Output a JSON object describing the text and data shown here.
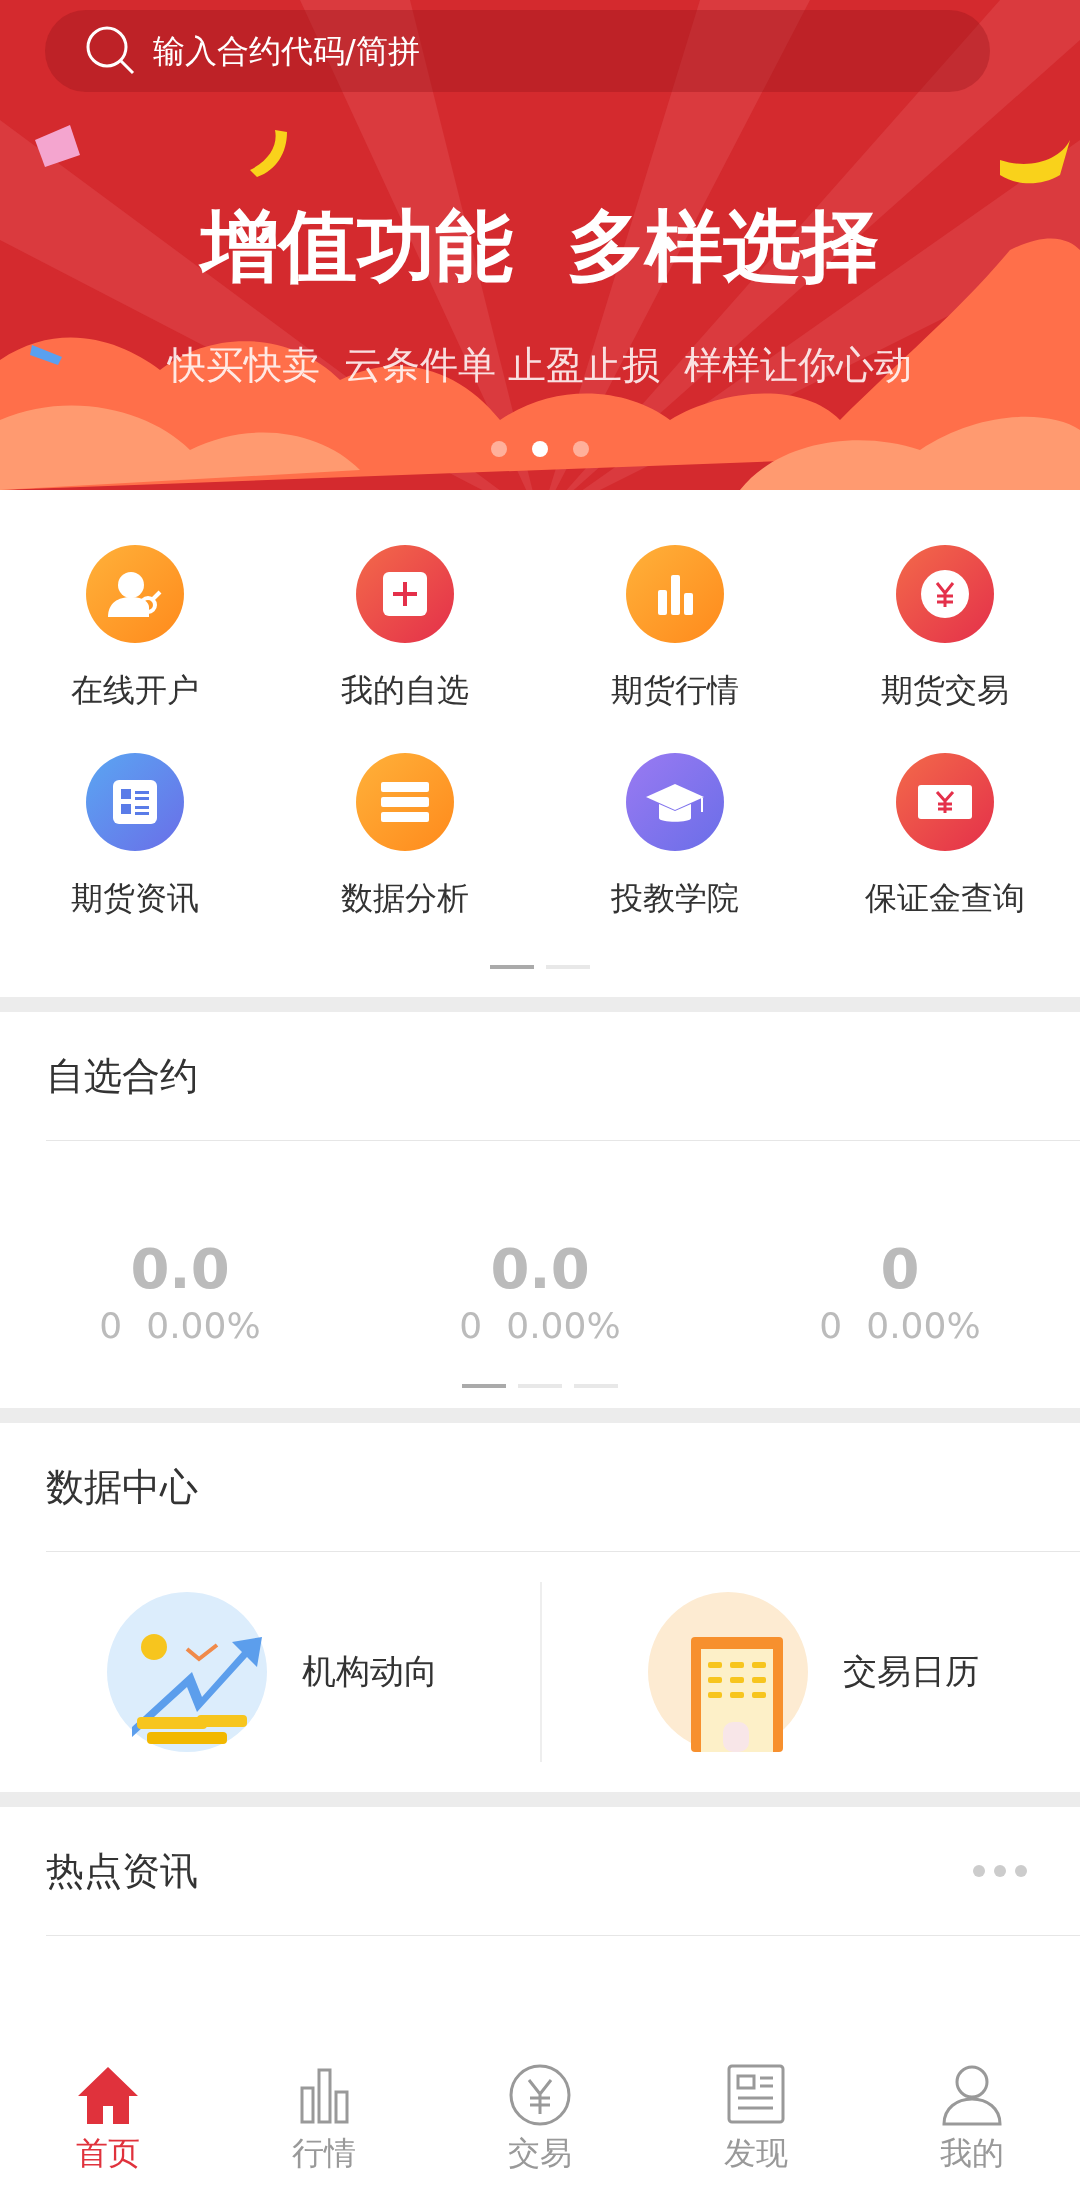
{
  "search": {
    "placeholder": "输入合约代码/简拼"
  },
  "banner": {
    "title": "增值功能  多样选择",
    "subtitle": "快买快卖  云条件单 止盈止损  样样让你心动",
    "dots": [
      {
        "selected": false
      },
      {
        "selected": true
      },
      {
        "selected": false
      }
    ]
  },
  "quick_menu": {
    "items": [
      {
        "label": "在线开户",
        "kind": "account"
      },
      {
        "label": "我的自选",
        "kind": "add"
      },
      {
        "label": "期货行情",
        "kind": "chart"
      },
      {
        "label": "期货交易",
        "kind": "yuan"
      },
      {
        "label": "期货资讯",
        "kind": "news"
      },
      {
        "label": "数据分析",
        "kind": "data"
      },
      {
        "label": "投教学院",
        "kind": "school"
      },
      {
        "label": "保证金查询",
        "kind": "margin"
      }
    ],
    "pages": [
      {
        "selected": true
      },
      {
        "selected": false
      }
    ]
  },
  "watchlist": {
    "title": "自选合约",
    "contracts": [
      {
        "price": "0.0",
        "change": "0",
        "percent": "0.00%"
      },
      {
        "price": "0.0",
        "change": "0",
        "percent": "0.00%"
      },
      {
        "price": "0",
        "change": "0",
        "percent": "0.00%"
      }
    ],
    "pages": [
      {
        "selected": true
      },
      {
        "selected": false
      },
      {
        "selected": false
      }
    ]
  },
  "data_center": {
    "title": "数据中心",
    "items": [
      {
        "label": "机构动向",
        "kind": "institution"
      },
      {
        "label": "交易日历",
        "kind": "calendar"
      }
    ]
  },
  "hot_news": {
    "title": "热点资讯"
  },
  "tab_bar": [
    {
      "label": "首页",
      "kind": "home",
      "selected": true
    },
    {
      "label": "行情",
      "kind": "market",
      "selected": false
    },
    {
      "label": "交易",
      "kind": "trade",
      "selected": false
    },
    {
      "label": "发现",
      "kind": "discover",
      "selected": false
    },
    {
      "label": "我的",
      "kind": "me",
      "selected": false
    }
  ]
}
